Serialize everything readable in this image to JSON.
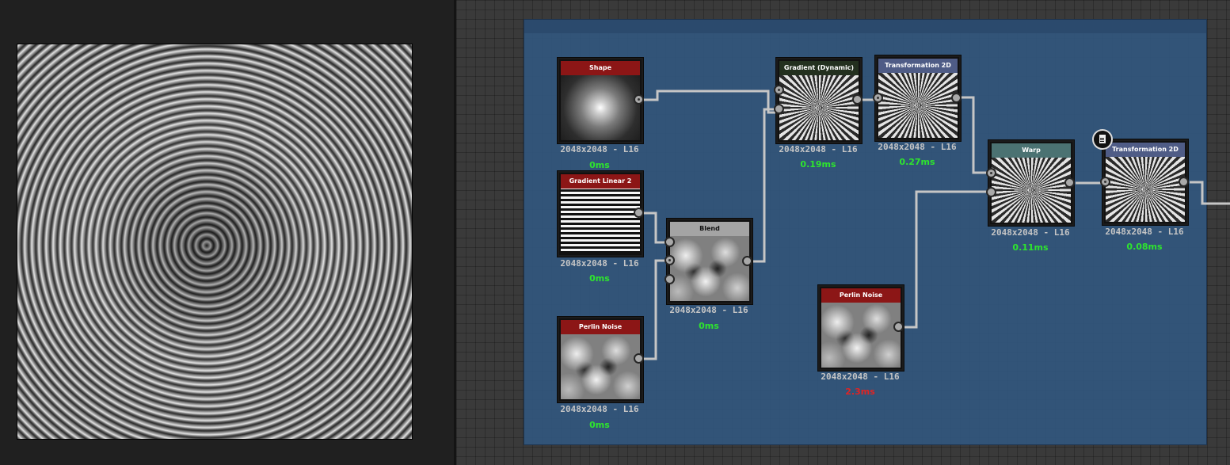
{
  "colors": {
    "green_time": "#2ee52e",
    "red_time": "#e02424",
    "header_red": "#8c1616",
    "header_grey": "#a4a4a4",
    "header_dark_green": "#23301f",
    "header_blue": "#4f5c86",
    "header_teal": "#4b7272"
  },
  "icons": {
    "comment": "document-comment-icon"
  },
  "nodes": {
    "shape": {
      "title": "Shape",
      "res": "2048x2048 - L16",
      "time": "0ms"
    },
    "gradient_linear": {
      "title": "Gradient Linear 2",
      "res": "2048x2048 - L16",
      "time": "0ms"
    },
    "perlin1": {
      "title": "Perlin Noise",
      "res": "2048x2048 - L16",
      "time": "0ms"
    },
    "blend": {
      "title": "Blend",
      "res": "2048x2048 - L16",
      "time": "0ms"
    },
    "gradient_dynamic": {
      "title": "Gradient (Dynamic)",
      "res": "2048x2048 - L16",
      "time": "0.19ms"
    },
    "transform1": {
      "title": "Transformation 2D",
      "res": "2048x2048 - L16",
      "time": "0.27ms"
    },
    "perlin2": {
      "title": "Perlin Noise",
      "res": "2048x2048 - L16",
      "time": "2.3ms"
    },
    "warp": {
      "title": "Warp",
      "res": "2048x2048 - L16",
      "time": "0.11ms"
    },
    "transform2": {
      "title": "Transformation 2D",
      "res": "2048x2048 - L16",
      "time": "0.08ms"
    }
  }
}
